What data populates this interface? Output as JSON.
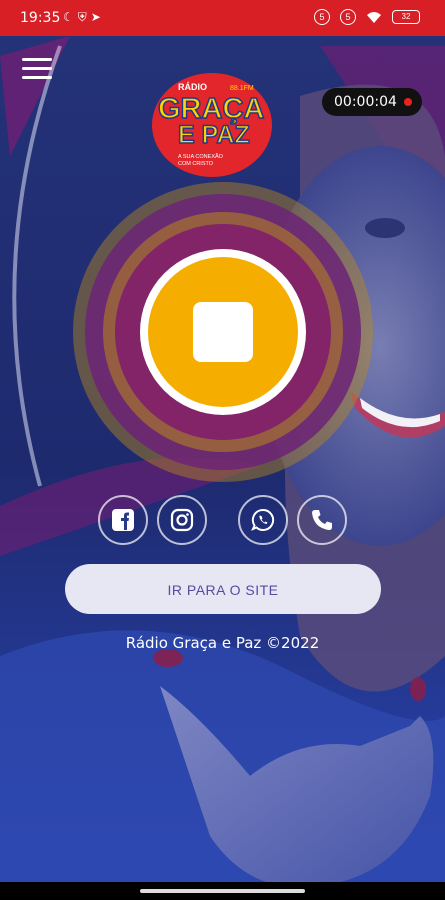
{
  "status_bar": {
    "time": "19:35",
    "left_icons": [
      "moon-icon",
      "shield-icon",
      "telegram-icon"
    ],
    "right_icons": [
      "sim-icon",
      "sim-icon",
      "wifi-icon"
    ],
    "sim1": "5",
    "sim2": "5",
    "battery": "32"
  },
  "header": {
    "menu_icon": "hamburger-icon",
    "logo": {
      "top": "RÁDIO",
      "freq": "88.1FM",
      "line1": "GRAÇA",
      "line2": "E PAZ",
      "tagline1": "A SUA CONEXÃO",
      "tagline2": "COM CRISTO"
    },
    "timer": "00:00:04"
  },
  "player": {
    "state_icon": "stop-icon"
  },
  "social": [
    {
      "name": "facebook",
      "icon": "facebook-icon"
    },
    {
      "name": "instagram",
      "icon": "instagram-icon"
    },
    {
      "name": "whatsapp",
      "icon": "whatsapp-icon"
    },
    {
      "name": "phone",
      "icon": "phone-icon"
    }
  ],
  "site_button": {
    "label": "IR PARA O SITE"
  },
  "footer": {
    "copyright": "Rádio Graça e Paz ©2022"
  },
  "colors": {
    "status_bar": "#d81f26",
    "background": "#18235e",
    "accent_yellow": "#f5ae00",
    "accent_purple": "#5a4aa0",
    "ring_magenta": "#8c1a6e"
  }
}
